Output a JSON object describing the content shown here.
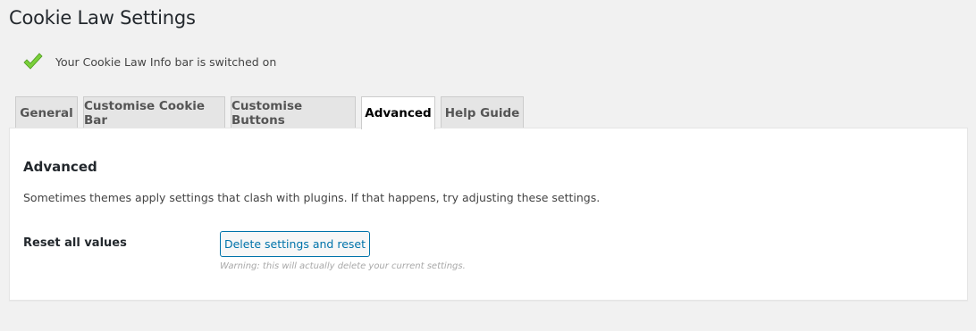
{
  "page": {
    "title": "Cookie Law Settings"
  },
  "notice": {
    "icon": "check-icon",
    "text": "Your Cookie Law Info bar is switched on",
    "icon_color": "#7ad03a"
  },
  "tabs": [
    {
      "label": "General",
      "active": false
    },
    {
      "label": "Customise Cookie Bar",
      "active": false
    },
    {
      "label": "Customise Buttons",
      "active": false
    },
    {
      "label": "Advanced",
      "active": true
    },
    {
      "label": "Help Guide",
      "active": false
    }
  ],
  "advanced": {
    "heading": "Advanced",
    "description": "Sometimes themes apply settings that clash with plugins. If that happens, try adjusting these settings.",
    "reset_label": "Reset all values",
    "reset_button": "Delete settings and reset",
    "warning": "Warning: this will actually delete your current settings."
  },
  "colors": {
    "accent": "#0073aa",
    "background": "#f1f1f1",
    "panel": "#ffffff"
  }
}
